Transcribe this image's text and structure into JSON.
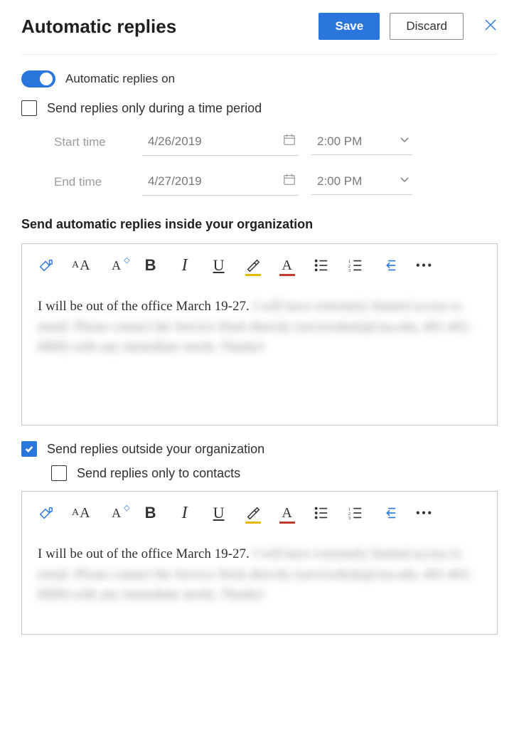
{
  "header": {
    "title": "Automatic replies",
    "save": "Save",
    "discard": "Discard"
  },
  "toggle": {
    "label": "Automatic replies on",
    "on": true
  },
  "timePeriod": {
    "checkboxLabel": "Send replies only during a time period",
    "checked": false,
    "startLabel": "Start time",
    "endLabel": "End time",
    "startDate": "4/26/2019",
    "endDate": "4/27/2019",
    "startTime": "2:00 PM",
    "endTime": "2:00 PM"
  },
  "inside": {
    "heading": "Send automatic replies inside your organization",
    "bodyVisible": "I will be out of the office March 19-27.",
    "bodyBlurred": "I will have extremely limited access to email. Please contact the Service Desk directly (servicedesk@cnu.edu, 401-401-0000) with any immediate needs. Thanks!"
  },
  "outside": {
    "checkboxLabel": "Send replies outside your organization",
    "checked": true,
    "contactsOnlyLabel": "Send replies only to contacts",
    "contactsOnlyChecked": false,
    "bodyVisible": "I will be out of the office March 19-27.",
    "bodyBlurred": "I will have extremely limited access to email. Please contact the Service Desk directly (servicedesk@cnu.edu, 401-401-0000) with any immediate needs. Thanks!"
  }
}
